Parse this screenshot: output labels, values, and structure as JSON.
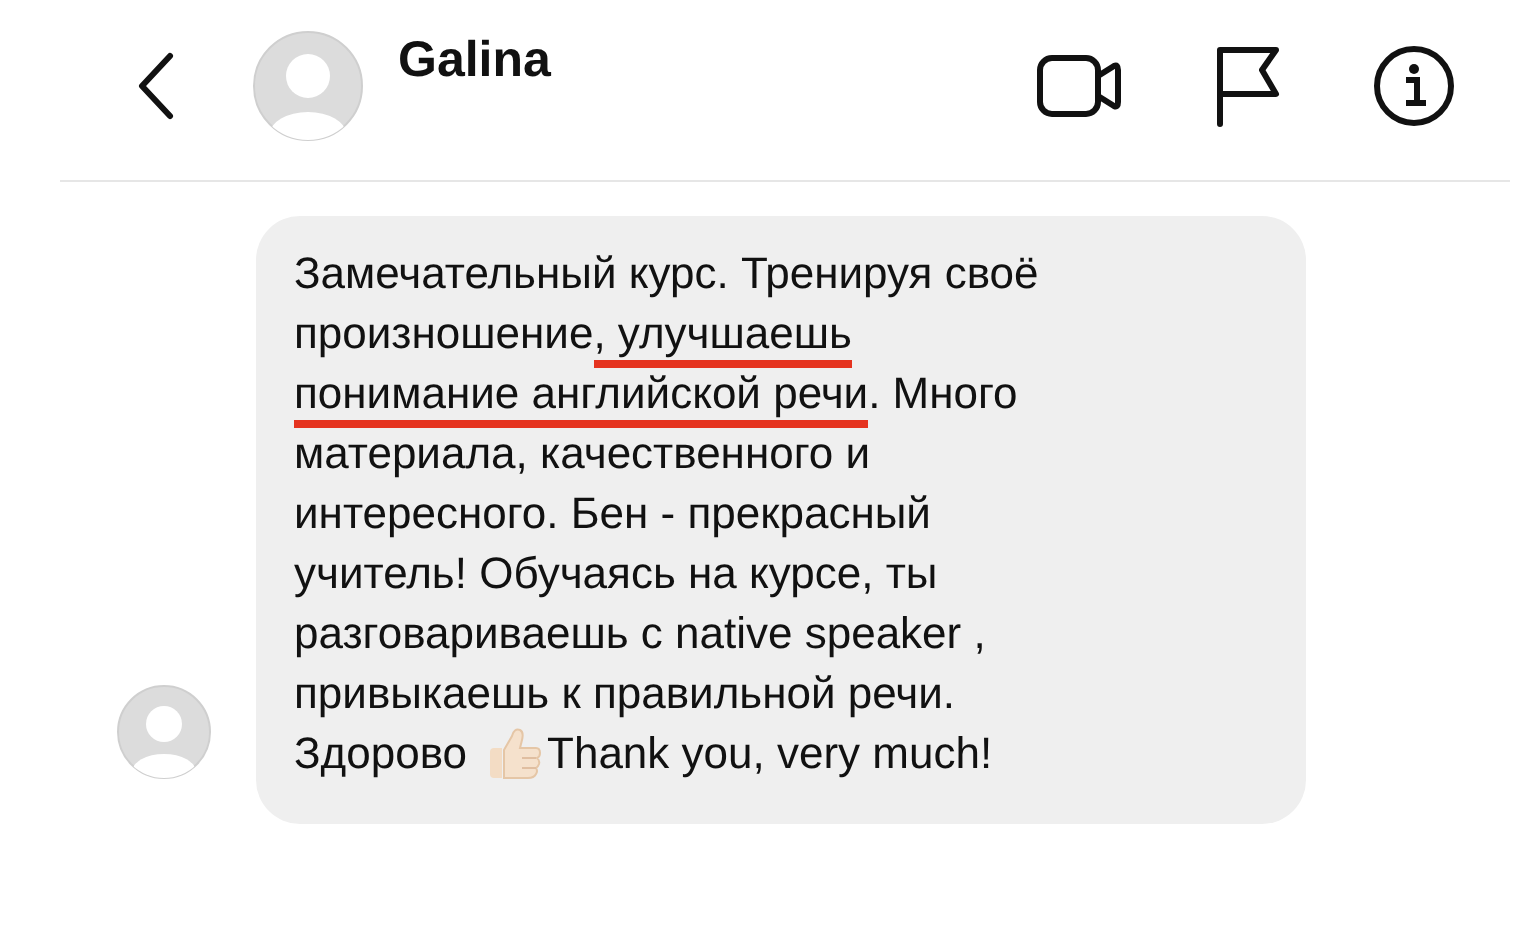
{
  "header": {
    "contact_name": "Galina"
  },
  "message": {
    "lines": [
      {
        "segments": [
          {
            "kind": "text",
            "text": "Замечательный курс. Тренируя своё",
            "marked": false
          }
        ]
      },
      {
        "segments": [
          {
            "kind": "text",
            "text": "произношение",
            "marked": false
          },
          {
            "kind": "text",
            "text": ", улучшаешь",
            "marked": true
          }
        ]
      },
      {
        "segments": [
          {
            "kind": "text",
            "text": "понимание английской речи",
            "marked": true
          },
          {
            "kind": "text",
            "text": ". Много",
            "marked": false
          }
        ]
      },
      {
        "segments": [
          {
            "kind": "text",
            "text": "материала, качественного и",
            "marked": false
          }
        ]
      },
      {
        "segments": [
          {
            "kind": "text",
            "text": "интересного. Бен - прекрасный",
            "marked": false
          }
        ]
      },
      {
        "segments": [
          {
            "kind": "text",
            "text": "учитель! Обучаясь на курсе, ты",
            "marked": false
          }
        ]
      },
      {
        "segments": [
          {
            "kind": "text",
            "text": "разговариваешь с native speaker ,",
            "marked": false
          }
        ]
      },
      {
        "segments": [
          {
            "kind": "text",
            "text": "привыкаешь к правильной речи.",
            "marked": false
          }
        ]
      },
      {
        "segments": [
          {
            "kind": "text",
            "text": "Здорово",
            "marked": false
          },
          {
            "kind": "emoji"
          },
          {
            "kind": "text",
            "text": "Thank you, very much!",
            "marked": false
          }
        ]
      }
    ]
  }
}
